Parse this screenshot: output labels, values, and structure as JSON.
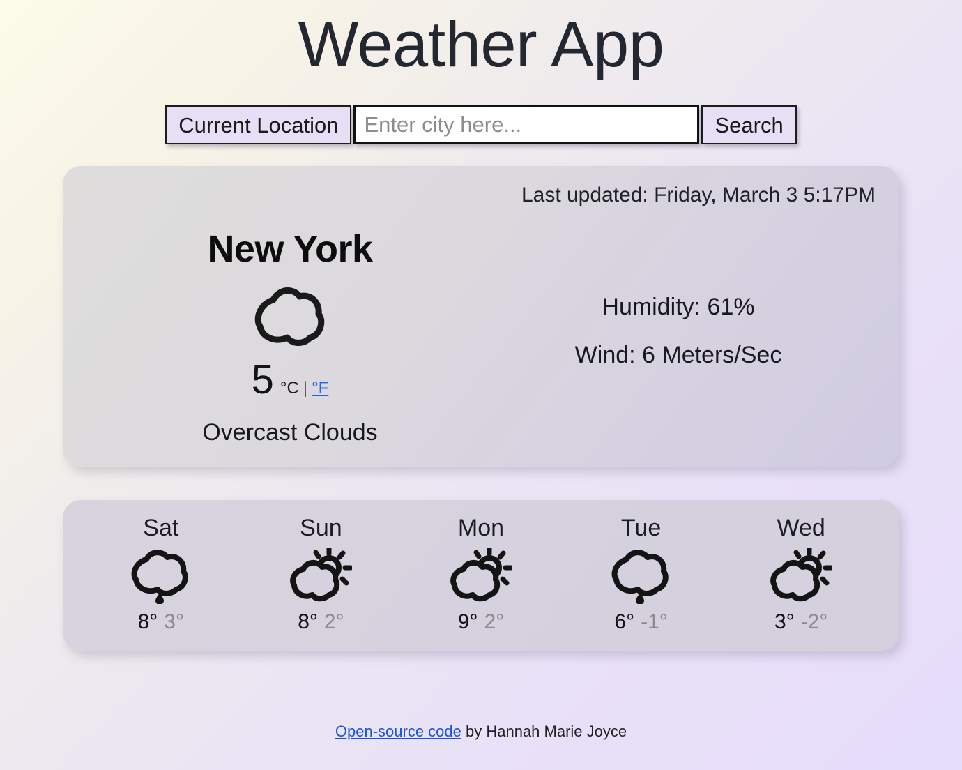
{
  "app": {
    "title": "Weather App"
  },
  "search": {
    "current_location_label": "Current Location",
    "input_value": "",
    "input_placeholder": "Enter city here...",
    "search_label": "Search"
  },
  "current": {
    "last_updated": "Last updated: Friday, March 3 5:17PM",
    "city": "New York",
    "icon": "overcast-clouds-icon",
    "temperature": "5",
    "unit_active": "°C",
    "unit_separator": "|",
    "unit_link": "°F",
    "description": "Overcast Clouds",
    "humidity": "Humidity: 61%",
    "wind": "Wind: 6 Meters/Sec"
  },
  "forecast": [
    {
      "day": "Sat",
      "icon": "rain-icon",
      "max": "8°",
      "min": "3°"
    },
    {
      "day": "Sun",
      "icon": "partly-sunny-icon",
      "max": "8°",
      "min": "2°"
    },
    {
      "day": "Mon",
      "icon": "partly-sunny-icon",
      "max": "9°",
      "min": "2°"
    },
    {
      "day": "Tue",
      "icon": "rain-icon",
      "max": "6°",
      "min": "-1°"
    },
    {
      "day": "Wed",
      "icon": "partly-sunny-icon",
      "max": "3°",
      "min": "-2°"
    }
  ],
  "footer": {
    "link_text": "Open-source code",
    "credit": " by Hannah Marie Joyce"
  },
  "colors": {
    "accent_link": "#1a56db",
    "unit_link": "#2563eb",
    "button_bg": "#e6dff5",
    "card_bg_start": "#dedddb",
    "card_bg_end": "#d0cbe2",
    "forecast_bg": "#d6d1de",
    "page_bg_start": "#fcfbe9",
    "page_bg_end": "#e6dcfb",
    "text_primary": "#1d1f24",
    "temp_min": "#8b8b8b"
  }
}
